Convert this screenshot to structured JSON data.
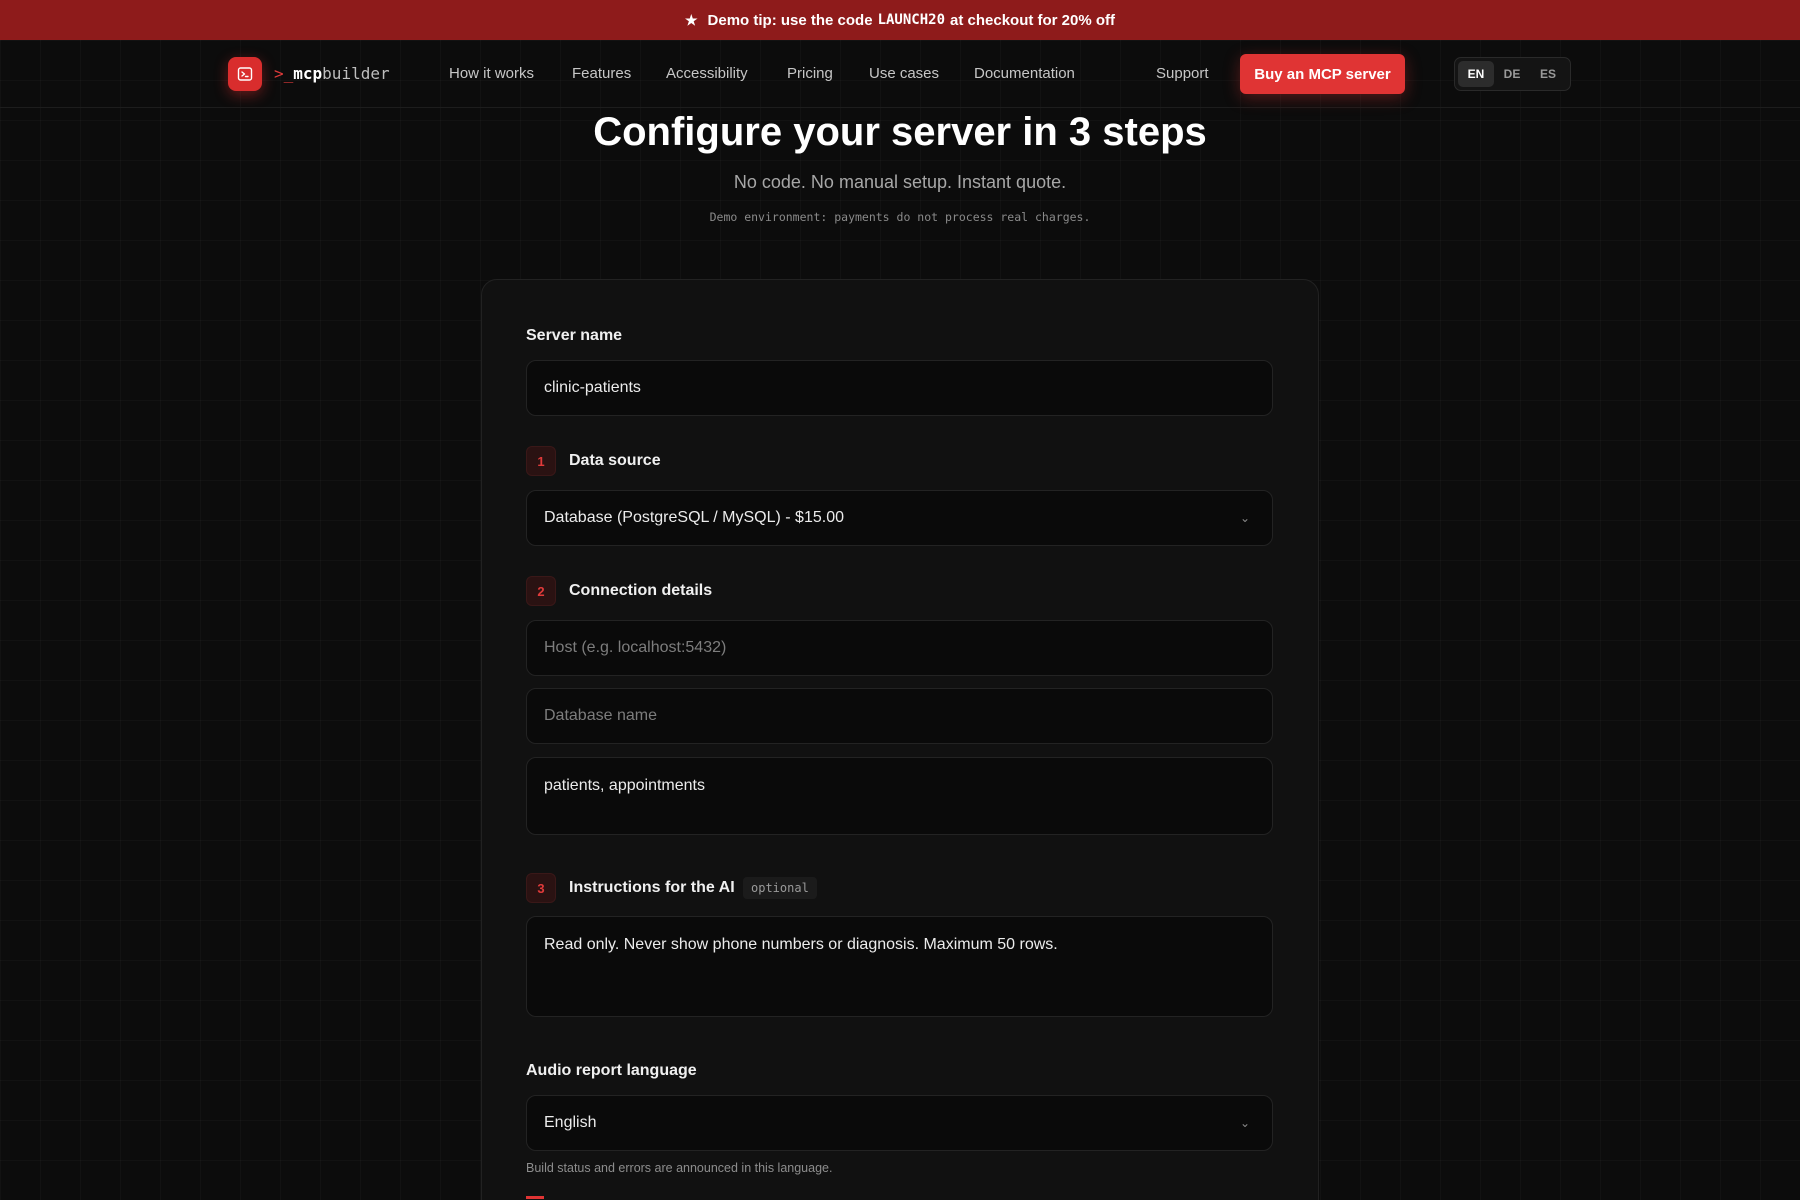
{
  "banner": {
    "star_icon": "star-icon",
    "text_before": "Demo tip: use the code",
    "code": "LAUNCH20",
    "text_after": "at checkout for 20% off"
  },
  "brand": {
    "prompt": ">_",
    "name_bold": "mcp",
    "name_rest": "builder",
    "icon": "terminal-icon",
    "accent_color": "#e03434"
  },
  "nav": {
    "links": [
      "How it works",
      "Features",
      "Accessibility",
      "Pricing",
      "Use cases",
      "Documentation"
    ],
    "support": "Support",
    "cta": "Buy an MCP server",
    "languages": [
      "EN",
      "DE",
      "ES"
    ],
    "active_language": "EN"
  },
  "hero": {
    "title": "Configure your server in 3 steps",
    "subtitle": "No code. No manual setup. Instant quote.",
    "note": "Demo environment: payments do not process real charges."
  },
  "form": {
    "server_name": {
      "label": "Server name",
      "value": "clinic-patients"
    },
    "step1": {
      "number": "1",
      "label": "Data source",
      "selected": "Database (PostgreSQL / MySQL) - $15.00"
    },
    "step2": {
      "number": "2",
      "label": "Connection details",
      "host_placeholder": "Host (e.g. localhost:5432)",
      "db_placeholder": "Database name",
      "tables_value": "patients, appointments"
    },
    "step3": {
      "number": "3",
      "label": "Instructions for the AI",
      "tag": "optional",
      "value": "Read only. Never show phone numbers or diagnosis. Maximum 50 rows."
    },
    "audio": {
      "label": "Audio report language",
      "selected": "English",
      "helper": "Build status and errors are announced in this language."
    }
  }
}
